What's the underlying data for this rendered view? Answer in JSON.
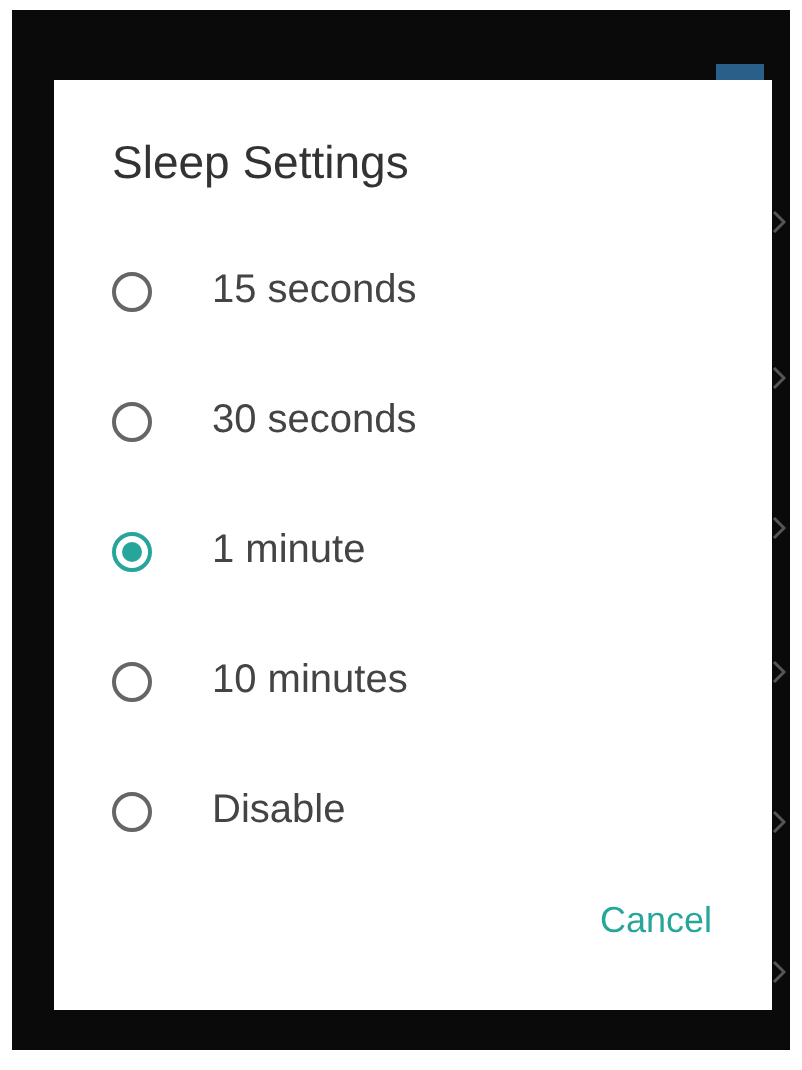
{
  "dialog": {
    "title": "Sleep Settings",
    "options": [
      {
        "label": "15 seconds",
        "selected": false
      },
      {
        "label": "30 seconds",
        "selected": false
      },
      {
        "label": "1 minute",
        "selected": true
      },
      {
        "label": "10 minutes",
        "selected": false
      },
      {
        "label": "Disable",
        "selected": false
      }
    ],
    "buttons": [
      "Cancel"
    ]
  }
}
